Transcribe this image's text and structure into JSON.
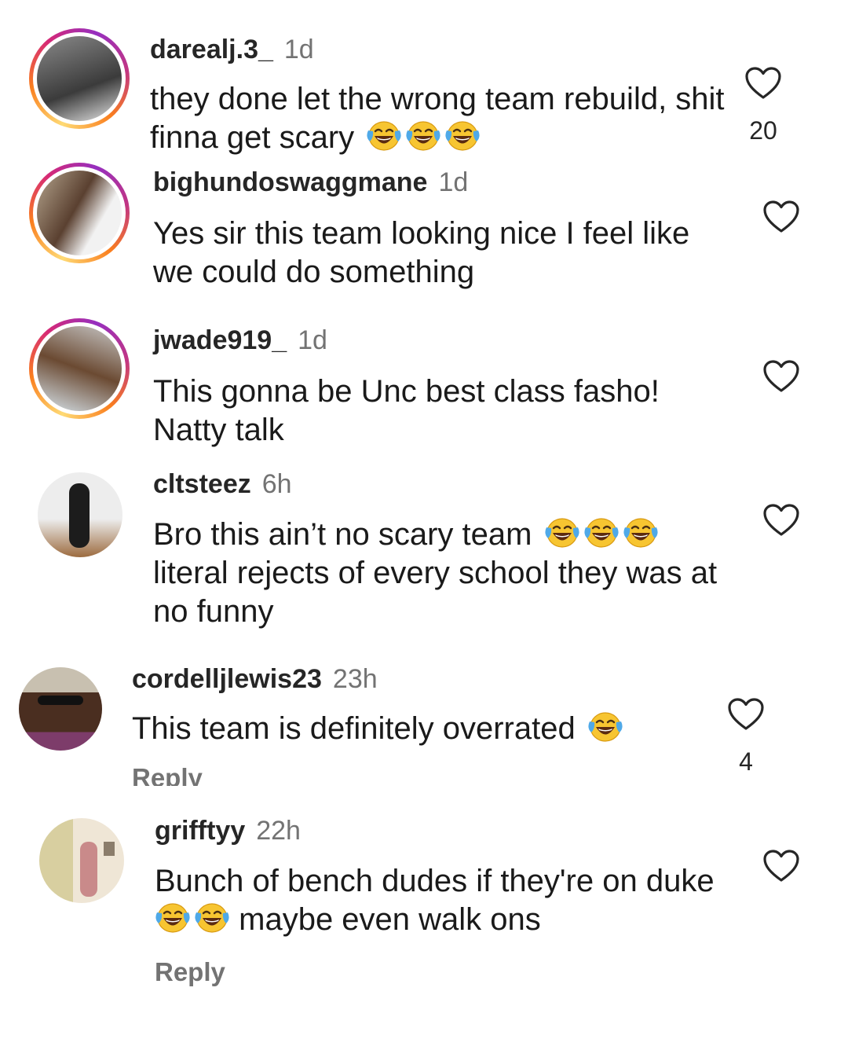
{
  "comments": [
    {
      "username": "darealj.3_",
      "time": "1d",
      "text": "they done let the wrong team rebuild, shit finna get scary",
      "emoji_count": 3,
      "likes": "20",
      "avatar_colors": [
        "#8a8a8a",
        "#3b3b3b",
        "#e8e8e8"
      ]
    },
    {
      "username": "bighundoswaggmane",
      "time": "1d",
      "text": "Yes sir this team looking nice I feel like we could do something",
      "emoji_count": 0,
      "likes": "",
      "avatar_colors": [
        "#b5a58e",
        "#5a4030",
        "#f2f2f2"
      ]
    },
    {
      "username": "jwade919_",
      "time": "1d",
      "text": "This gonna be Unc best class fasho! Natty talk",
      "emoji_count": 0,
      "likes": "",
      "avatar_colors": [
        "#c9c9c9",
        "#6b4a32",
        "#d9e6ee"
      ]
    },
    {
      "username": "cltsteez",
      "time": "6h",
      "text": "Bro this ain’t no scary team",
      "text_after_emoji": "literal rejects of every school they was at no funny",
      "emoji_count": 3,
      "likes": "",
      "avatar_colors": [
        "#ededed",
        "#1c1c1c",
        "#9c6b3f"
      ]
    },
    {
      "username": "cordelljlewis23",
      "time": "23h",
      "text": "This team is definitely overrated",
      "emoji_count": 1,
      "likes": "4",
      "reply_label": "Reply",
      "avatar_colors": [
        "#c8c0b0",
        "#4a2e20",
        "#7d3c6a"
      ]
    },
    {
      "username": "grifftyy",
      "time": "22h",
      "text_before_emoji": "Bunch of bench dudes if they're on duke",
      "text_after_emoji": "maybe even walk ons",
      "emoji_count": 2,
      "likes": "",
      "reply_label": "Reply",
      "avatar_colors": [
        "#d8cfa0",
        "#c98a8a",
        "#b0a070"
      ]
    }
  ],
  "icons": {
    "like": "heart-outline-icon",
    "emoji": "face-with-tears-of-joy-emoji"
  }
}
